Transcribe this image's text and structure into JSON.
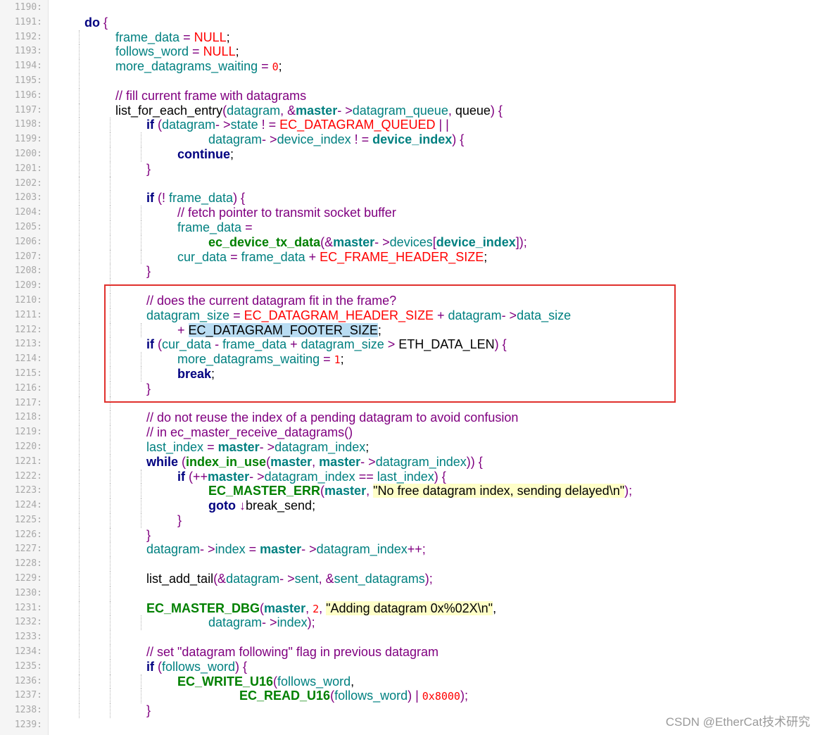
{
  "editor": {
    "watermark": "CSDN @EtherCat技术研究",
    "highlight_box_color": "#e0302c",
    "colors": {
      "keyword": "#000080",
      "identifier": "#008080",
      "function_macro": "#008000",
      "operator": "#800080",
      "comment": "#800080",
      "constant": "#ff0000",
      "string_bg": "#ffffc8",
      "selection_bg": "#b9dcf2",
      "line_number": "#a8a8a8"
    },
    "lines": [
      {
        "n": "1190:",
        "indent": 0,
        "tokens": []
      },
      {
        "n": "1191:",
        "indent": 0,
        "tokens": [
          {
            "t": "do",
            "c": "kw"
          },
          {
            "t": " {",
            "c": "op"
          }
        ]
      },
      {
        "n": "1192:",
        "indent": 1,
        "tokens": [
          {
            "t": "frame_data",
            "c": "id"
          },
          {
            "t": " = ",
            "c": "op"
          },
          {
            "t": "NULL",
            "c": "const"
          },
          {
            "t": ";",
            "c": "pl"
          }
        ]
      },
      {
        "n": "1193:",
        "indent": 1,
        "tokens": [
          {
            "t": "follows_word",
            "c": "id"
          },
          {
            "t": " = ",
            "c": "op"
          },
          {
            "t": "NULL",
            "c": "const"
          },
          {
            "t": ";",
            "c": "pl"
          }
        ]
      },
      {
        "n": "1194:",
        "indent": 1,
        "tokens": [
          {
            "t": "more_datagrams_waiting",
            "c": "id"
          },
          {
            "t": " = ",
            "c": "op"
          },
          {
            "t": "0",
            "c": "num"
          },
          {
            "t": ";",
            "c": "pl"
          }
        ]
      },
      {
        "n": "1195:",
        "indent": 1,
        "tokens": []
      },
      {
        "n": "1196:",
        "indent": 1,
        "tokens": [
          {
            "t": "// fill current frame with datagrams",
            "c": "cm"
          }
        ]
      },
      {
        "n": "1197:",
        "indent": 1,
        "tokens": [
          {
            "t": "list_for_each_entry",
            "c": "pl"
          },
          {
            "t": "(",
            "c": "op"
          },
          {
            "t": "datagram",
            "c": "id"
          },
          {
            "t": ", &",
            "c": "op"
          },
          {
            "t": "master",
            "c": "bid"
          },
          {
            "t": "- >",
            "c": "op"
          },
          {
            "t": "datagram_queue",
            "c": "id"
          },
          {
            "t": ", ",
            "c": "op"
          },
          {
            "t": "queue",
            "c": "pl"
          },
          {
            "t": ") {",
            "c": "op"
          }
        ]
      },
      {
        "n": "1198:",
        "indent": 2,
        "tokens": [
          {
            "t": "if",
            "c": "kw"
          },
          {
            "t": " (",
            "c": "op"
          },
          {
            "t": "datagram",
            "c": "id"
          },
          {
            "t": "- >",
            "c": "op"
          },
          {
            "t": "state",
            "c": "id"
          },
          {
            "t": " ! = ",
            "c": "op"
          },
          {
            "t": "EC_DATAGRAM_QUEUED",
            "c": "const"
          },
          {
            "t": " | |",
            "c": "op"
          }
        ]
      },
      {
        "n": "1199:",
        "indent": 4,
        "tokens": [
          {
            "t": "datagram",
            "c": "id"
          },
          {
            "t": "- >",
            "c": "op"
          },
          {
            "t": "device_index",
            "c": "id"
          },
          {
            "t": " ! = ",
            "c": "op"
          },
          {
            "t": "device_index",
            "c": "bid"
          },
          {
            "t": ") {",
            "c": "op"
          }
        ]
      },
      {
        "n": "1200:",
        "indent": 3,
        "tokens": [
          {
            "t": "continue",
            "c": "kw"
          },
          {
            "t": ";",
            "c": "pl"
          }
        ]
      },
      {
        "n": "1201:",
        "indent": 2,
        "tokens": [
          {
            "t": "}",
            "c": "op"
          }
        ]
      },
      {
        "n": "1202:",
        "indent": 2,
        "tokens": []
      },
      {
        "n": "1203:",
        "indent": 2,
        "tokens": [
          {
            "t": "if",
            "c": "kw"
          },
          {
            "t": " (! ",
            "c": "op"
          },
          {
            "t": "frame_data",
            "c": "id"
          },
          {
            "t": ") {",
            "c": "op"
          }
        ]
      },
      {
        "n": "1204:",
        "indent": 3,
        "tokens": [
          {
            "t": "// fetch pointer to transmit socket buffer",
            "c": "cm"
          }
        ]
      },
      {
        "n": "1205:",
        "indent": 3,
        "tokens": [
          {
            "t": "frame_data",
            "c": "id"
          },
          {
            "t": " =",
            "c": "op"
          }
        ]
      },
      {
        "n": "1206:",
        "indent": 4,
        "tokens": [
          {
            "t": "ec_device_tx_data",
            "c": "fn"
          },
          {
            "t": "(&",
            "c": "op"
          },
          {
            "t": "master",
            "c": "bid"
          },
          {
            "t": "- >",
            "c": "op"
          },
          {
            "t": "devices",
            "c": "id"
          },
          {
            "t": "[",
            "c": "op"
          },
          {
            "t": "device_index",
            "c": "bid"
          },
          {
            "t": "]);",
            "c": "op"
          }
        ]
      },
      {
        "n": "1207:",
        "indent": 3,
        "tokens": [
          {
            "t": "cur_data",
            "c": "id"
          },
          {
            "t": " = ",
            "c": "op"
          },
          {
            "t": "frame_data",
            "c": "id"
          },
          {
            "t": " + ",
            "c": "op"
          },
          {
            "t": "EC_FRAME_HEADER_SIZE",
            "c": "const"
          },
          {
            "t": ";",
            "c": "pl"
          }
        ]
      },
      {
        "n": "1208:",
        "indent": 2,
        "tokens": [
          {
            "t": "}",
            "c": "op"
          }
        ]
      },
      {
        "n": "1209:",
        "indent": 2,
        "tokens": []
      },
      {
        "n": "1210:",
        "indent": 2,
        "tokens": [
          {
            "t": "// does the current datagram fit in the frame?",
            "c": "cm"
          }
        ]
      },
      {
        "n": "1211:",
        "indent": 2,
        "tokens": [
          {
            "t": "datagram_size",
            "c": "id"
          },
          {
            "t": " = ",
            "c": "op"
          },
          {
            "t": "EC_DATAGRAM_HEADER_SIZE",
            "c": "const"
          },
          {
            "t": " + ",
            "c": "op"
          },
          {
            "t": "datagram",
            "c": "id"
          },
          {
            "t": "- >",
            "c": "op"
          },
          {
            "t": "data_size",
            "c": "id"
          }
        ]
      },
      {
        "n": "1212:",
        "indent": 3,
        "tokens": [
          {
            "t": "+ ",
            "c": "op"
          },
          {
            "t": "EC_DATAGRAM_FOOTER_SIZE",
            "c": "sel"
          },
          {
            "t": ";",
            "c": "pl"
          }
        ]
      },
      {
        "n": "1213:",
        "indent": 2,
        "tokens": [
          {
            "t": "if",
            "c": "kw"
          },
          {
            "t": " (",
            "c": "op"
          },
          {
            "t": "cur_data",
            "c": "id"
          },
          {
            "t": " - ",
            "c": "op"
          },
          {
            "t": "frame_data",
            "c": "id"
          },
          {
            "t": " + ",
            "c": "op"
          },
          {
            "t": "datagram_size",
            "c": "id"
          },
          {
            "t": " > ",
            "c": "op"
          },
          {
            "t": "ETH_DATA_LEN",
            "c": "pl"
          },
          {
            "t": ") {",
            "c": "op"
          }
        ]
      },
      {
        "n": "1214:",
        "indent": 3,
        "tokens": [
          {
            "t": "more_datagrams_waiting",
            "c": "id"
          },
          {
            "t": " = ",
            "c": "op"
          },
          {
            "t": "1",
            "c": "num"
          },
          {
            "t": ";",
            "c": "pl"
          }
        ]
      },
      {
        "n": "1215:",
        "indent": 3,
        "tokens": [
          {
            "t": "break",
            "c": "kw"
          },
          {
            "t": ";",
            "c": "pl"
          }
        ]
      },
      {
        "n": "1216:",
        "indent": 2,
        "tokens": [
          {
            "t": "}",
            "c": "op"
          }
        ]
      },
      {
        "n": "1217:",
        "indent": 2,
        "tokens": []
      },
      {
        "n": "1218:",
        "indent": 2,
        "tokens": [
          {
            "t": "// do not reuse the index of a pending datagram to avoid confusion",
            "c": "cm"
          }
        ]
      },
      {
        "n": "1219:",
        "indent": 2,
        "tokens": [
          {
            "t": "// in ec_master_receive_datagrams()",
            "c": "cm"
          }
        ]
      },
      {
        "n": "1220:",
        "indent": 2,
        "tokens": [
          {
            "t": "last_index",
            "c": "id"
          },
          {
            "t": " = ",
            "c": "op"
          },
          {
            "t": "master",
            "c": "bid"
          },
          {
            "t": "- >",
            "c": "op"
          },
          {
            "t": "datagram_index",
            "c": "id"
          },
          {
            "t": ";",
            "c": "pl"
          }
        ]
      },
      {
        "n": "1221:",
        "indent": 2,
        "tokens": [
          {
            "t": "while",
            "c": "kw"
          },
          {
            "t": " (",
            "c": "op"
          },
          {
            "t": "index_in_use",
            "c": "fn"
          },
          {
            "t": "(",
            "c": "op"
          },
          {
            "t": "master",
            "c": "bid"
          },
          {
            "t": ", ",
            "c": "op"
          },
          {
            "t": "master",
            "c": "bid"
          },
          {
            "t": "- >",
            "c": "op"
          },
          {
            "t": "datagram_index",
            "c": "id"
          },
          {
            "t": ")) {",
            "c": "op"
          }
        ]
      },
      {
        "n": "1222:",
        "indent": 3,
        "tokens": [
          {
            "t": "if",
            "c": "kw"
          },
          {
            "t": " (++",
            "c": "op"
          },
          {
            "t": "master",
            "c": "bid"
          },
          {
            "t": "- >",
            "c": "op"
          },
          {
            "t": "datagram_index",
            "c": "id"
          },
          {
            "t": " == ",
            "c": "op"
          },
          {
            "t": "last_index",
            "c": "id"
          },
          {
            "t": ") {",
            "c": "op"
          }
        ]
      },
      {
        "n": "1223:",
        "indent": 4,
        "tokens": [
          {
            "t": "EC_MASTER_ERR",
            "c": "fn"
          },
          {
            "t": "(",
            "c": "op"
          },
          {
            "t": "master",
            "c": "bid"
          },
          {
            "t": ", ",
            "c": "op"
          },
          {
            "t": "\"No free datagram index, sending delayed\\n\"",
            "c": "str"
          },
          {
            "t": ");",
            "c": "op"
          }
        ]
      },
      {
        "n": "1224:",
        "indent": 4,
        "tokens": [
          {
            "t": "goto",
            "c": "kw"
          },
          {
            "t": " ↓",
            "c": "op"
          },
          {
            "t": "break_send",
            "c": "pl"
          },
          {
            "t": ";",
            "c": "pl"
          }
        ]
      },
      {
        "n": "1225:",
        "indent": 3,
        "tokens": [
          {
            "t": "}",
            "c": "op"
          }
        ]
      },
      {
        "n": "1226:",
        "indent": 2,
        "tokens": [
          {
            "t": "}",
            "c": "op"
          }
        ]
      },
      {
        "n": "1227:",
        "indent": 2,
        "tokens": [
          {
            "t": "datagram",
            "c": "id"
          },
          {
            "t": "- >",
            "c": "op"
          },
          {
            "t": "index",
            "c": "id"
          },
          {
            "t": " = ",
            "c": "op"
          },
          {
            "t": "master",
            "c": "bid"
          },
          {
            "t": "- >",
            "c": "op"
          },
          {
            "t": "datagram_index",
            "c": "id"
          },
          {
            "t": "++;",
            "c": "op"
          }
        ]
      },
      {
        "n": "1228:",
        "indent": 2,
        "tokens": []
      },
      {
        "n": "1229:",
        "indent": 2,
        "tokens": [
          {
            "t": "list_add_tail",
            "c": "pl"
          },
          {
            "t": "(&",
            "c": "op"
          },
          {
            "t": "datagram",
            "c": "id"
          },
          {
            "t": "- >",
            "c": "op"
          },
          {
            "t": "sent",
            "c": "id"
          },
          {
            "t": ", &",
            "c": "op"
          },
          {
            "t": "sent_datagrams",
            "c": "id"
          },
          {
            "t": ");",
            "c": "op"
          }
        ]
      },
      {
        "n": "1230:",
        "indent": 2,
        "tokens": []
      },
      {
        "n": "1231:",
        "indent": 2,
        "tokens": [
          {
            "t": "EC_MASTER_DBG",
            "c": "fn"
          },
          {
            "t": "(",
            "c": "op"
          },
          {
            "t": "master",
            "c": "bid"
          },
          {
            "t": ", ",
            "c": "op"
          },
          {
            "t": "2",
            "c": "num"
          },
          {
            "t": ", ",
            "c": "op"
          },
          {
            "t": "\"Adding datagram 0x%02X\\n\"",
            "c": "str"
          },
          {
            "t": ",",
            "c": "pl"
          }
        ]
      },
      {
        "n": "1232:",
        "indent": 4,
        "tokens": [
          {
            "t": "datagram",
            "c": "id"
          },
          {
            "t": "- >",
            "c": "op"
          },
          {
            "t": "index",
            "c": "id"
          },
          {
            "t": ");",
            "c": "op"
          }
        ]
      },
      {
        "n": "1233:",
        "indent": 2,
        "tokens": []
      },
      {
        "n": "1234:",
        "indent": 2,
        "tokens": [
          {
            "t": "// set \"datagram following\" flag in previous datagram",
            "c": "cm"
          }
        ]
      },
      {
        "n": "1235:",
        "indent": 2,
        "tokens": [
          {
            "t": "if",
            "c": "kw"
          },
          {
            "t": " (",
            "c": "op"
          },
          {
            "t": "follows_word",
            "c": "id"
          },
          {
            "t": ") {",
            "c": "op"
          }
        ]
      },
      {
        "n": "1236:",
        "indent": 3,
        "tokens": [
          {
            "t": "EC_WRITE_U16",
            "c": "fn"
          },
          {
            "t": "(",
            "c": "op"
          },
          {
            "t": "follows_word",
            "c": "id"
          },
          {
            "t": ",",
            "c": "pl"
          }
        ]
      },
      {
        "n": "1237:",
        "indent": 5,
        "tokens": [
          {
            "t": "EC_READ_U16",
            "c": "fn"
          },
          {
            "t": "(",
            "c": "op"
          },
          {
            "t": "follows_word",
            "c": "id"
          },
          {
            "t": ") | ",
            "c": "op"
          },
          {
            "t": "0x8000",
            "c": "num"
          },
          {
            "t": ");",
            "c": "op"
          }
        ]
      },
      {
        "n": "1238:",
        "indent": 2,
        "tokens": [
          {
            "t": "}",
            "c": "op"
          }
        ]
      },
      {
        "n": "1239:",
        "indent": 0,
        "tokens": []
      }
    ]
  }
}
